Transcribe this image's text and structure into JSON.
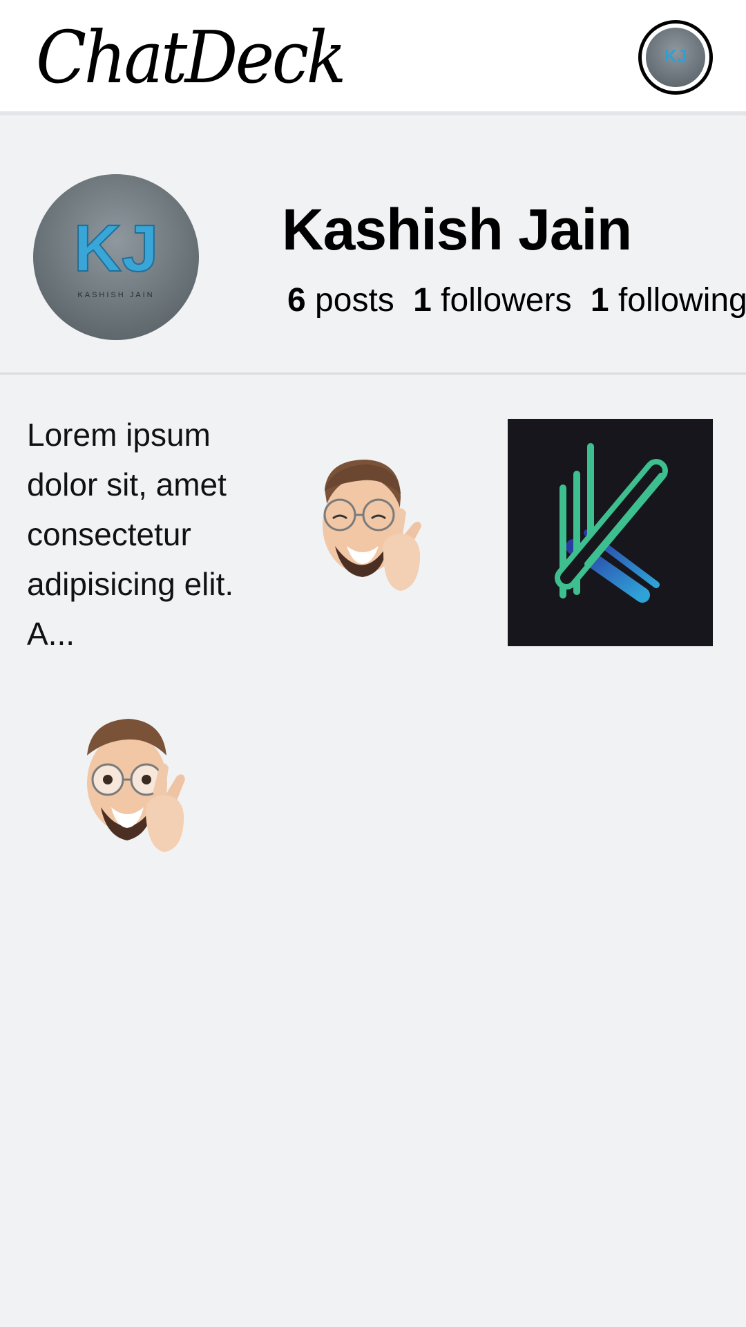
{
  "app": {
    "logo_text": "ChatDeck"
  },
  "header": {
    "avatar_initials": "KJ"
  },
  "profile": {
    "avatar_initials": "KJ",
    "avatar_subtext": "KASHISH JAIN",
    "name": "Kashish Jain",
    "stats": {
      "posts_count": "6",
      "posts_label": "posts",
      "followers_count": "1",
      "followers_label": "followers",
      "following_count": "1",
      "following_label": "following"
    }
  },
  "posts": {
    "caption": "Lorem ipsum dolor sit, amet consectetur adipisicing elit. A...",
    "icons": [
      "memoji-fingers-crossed-icon",
      "k-logo-icon",
      "memoji-peace-sign-icon"
    ]
  },
  "colors": {
    "accent_blue": "#2f9fd6",
    "k_green": "#3dbf8f",
    "k_blue": "#2a3fa8"
  }
}
